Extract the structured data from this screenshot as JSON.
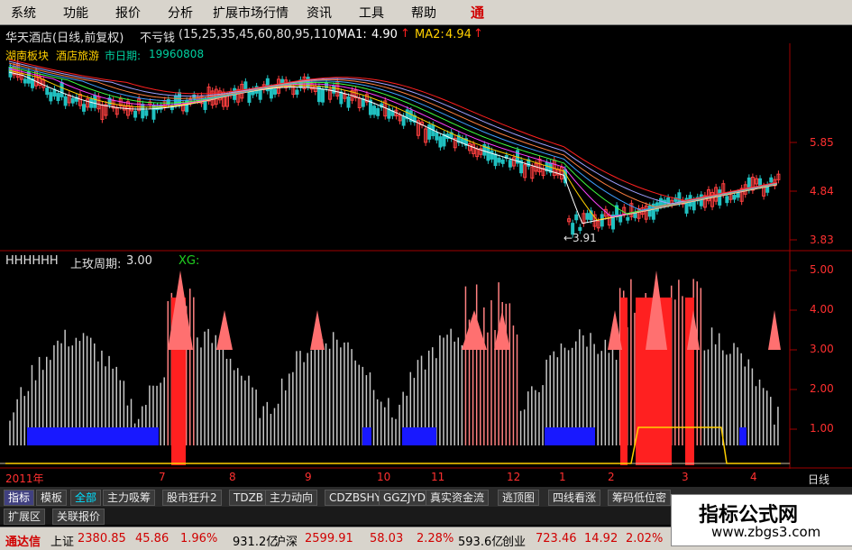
{
  "menu": {
    "items": [
      "系统",
      "功能",
      "报价",
      "分析",
      "扩展市场行情",
      "资讯",
      "工具",
      "帮助"
    ],
    "brand": "通"
  },
  "header": {
    "stock_title": "华天酒店(日线,前复权)",
    "formula_name": "不亏钱",
    "formula_params": "(15,25,35,45,60,80,95,110)",
    "ma1_label": "MA1:",
    "ma1_value": "4.90",
    "ma2_label": "MA2:",
    "ma2_value": "4.94",
    "sector_label": "湖南板块",
    "industry_label": "酒店旅游",
    "listing_label": "市日期:",
    "listing_date": "19960808",
    "arrow_up": "↑"
  },
  "price_axis": {
    "labels": [
      "5.85",
      "4.84",
      "3.83"
    ],
    "min_marker": "←3.91"
  },
  "indicator": {
    "name": "HHHHHH",
    "param_label": "上玫周期:",
    "param_value": "3.00",
    "xg_label": "XG:",
    "axis_labels": [
      "5.00",
      "4.00",
      "3.00",
      "2.00",
      "1.00"
    ]
  },
  "time_axis": {
    "labels": [
      "2011年",
      "7",
      "8",
      "9",
      "10",
      "11",
      "12",
      "1",
      "2",
      "3",
      "4"
    ],
    "period": "日线"
  },
  "tabs": {
    "items": [
      "指标",
      "模板",
      "全部",
      "主力吸筹",
      "股市狂升2",
      "TDZB",
      "主力动向",
      "CDZBSHY",
      "GGZJYD",
      "真实资金流",
      "逃顶图",
      "四线看涨",
      "筹码低位密"
    ],
    "row2": [
      "扩展区",
      "关联报价"
    ]
  },
  "status": {
    "app": "通达信",
    "sh_label": "上证",
    "sh_value": "2380.85",
    "sh_change": "45.86",
    "sh_pct": "1.96%",
    "sh_amount": "931.2亿",
    "sz_label": "沪深",
    "sz_value": "2599.91",
    "sz_change": "58.03",
    "sz_pct": "2.28%",
    "sz_amount": "593.6亿",
    "cy_label": "创业",
    "cy_value": "723.46",
    "cy_change": "14.92",
    "cy_pct": "2.02%"
  },
  "watermark": {
    "title": "指标公式网",
    "url": "www.zbgs3.com"
  },
  "colors": {
    "red": "#ff2020",
    "pink": "#ff8080",
    "blue": "#1818ff",
    "yellow": "#ffd000",
    "axis": "#a00000"
  }
}
